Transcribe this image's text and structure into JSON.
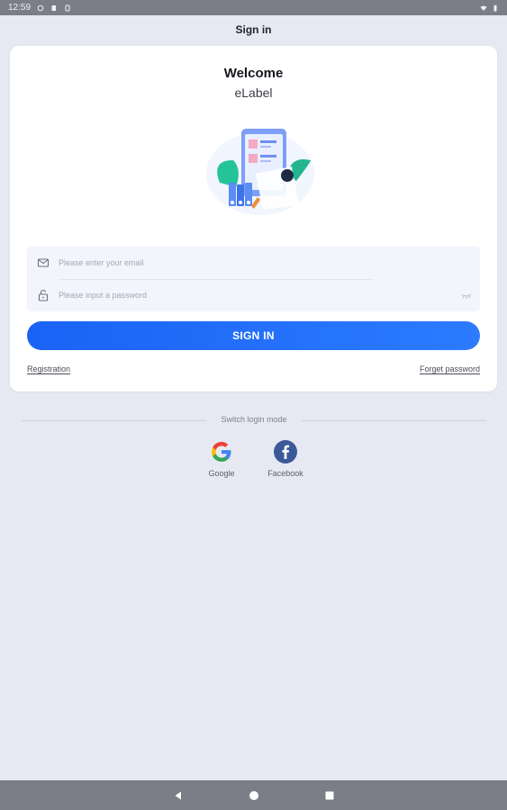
{
  "status_bar": {
    "time": "12:59"
  },
  "header": {
    "title": "Sign in"
  },
  "card": {
    "welcome": "Welcome",
    "app_name": "eLabel",
    "email": {
      "placeholder": "Please enter your email",
      "value": ""
    },
    "password": {
      "placeholder": "Please input a password",
      "value": ""
    },
    "sign_in_label": "SIGN IN",
    "registration_label": "Registration",
    "forget_password_label": "Forget password"
  },
  "alt_login": {
    "title": "Switch login mode",
    "options": [
      {
        "label": "Google",
        "icon": "google-icon"
      },
      {
        "label": "Facebook",
        "icon": "facebook-icon"
      }
    ]
  },
  "nav_bar": {
    "buttons": [
      "back-icon",
      "home-icon",
      "recents-icon"
    ]
  },
  "colors": {
    "background": "#e7e9f2",
    "accent": "#1a63f5",
    "card": "#ffffff",
    "input_bg": "#f2f5fc",
    "system_bar": "#7c7e87",
    "facebook": "#3b5998"
  }
}
